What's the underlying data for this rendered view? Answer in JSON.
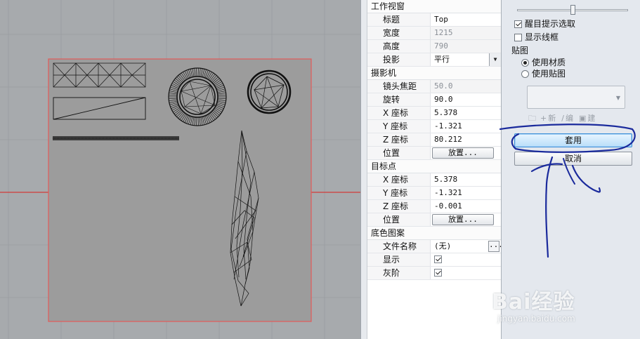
{
  "viewport": {
    "grid_color": "#999ca0",
    "axis_color": "#d23a3a",
    "frame_color": "#e35a5a"
  },
  "properties": {
    "sections": {
      "viewport_window": "工作视窗",
      "camera": "摄影机",
      "target": "目标点",
      "background": "底色图案"
    },
    "viewport_window": {
      "title_label": "标题",
      "title_value": "Top",
      "width_label": "宽度",
      "width_value": "1215",
      "height_label": "高度",
      "height_value": "790",
      "projection_label": "投影",
      "projection_value": "平行"
    },
    "camera": {
      "lens_label": "镜头焦距",
      "lens_value": "50.0",
      "rotation_label": "旋转",
      "rotation_value": "90.0",
      "x_label": "X 座标",
      "x_value": "5.378",
      "y_label": "Y 座标",
      "y_value": "-1.321",
      "z_label": "Z 座标",
      "z_value": "80.212",
      "position_label": "位置",
      "place_button": "放置..."
    },
    "target": {
      "x_label": "X 座标",
      "x_value": "5.378",
      "y_label": "Y 座标",
      "y_value": "-1.321",
      "z_label": "Z 座标",
      "z_value": "-0.001",
      "position_label": "位置",
      "place_button": "放置..."
    },
    "background": {
      "filename_label": "文件名称",
      "filename_value": "(无)",
      "browse_button": "...",
      "show_label": "显示",
      "gray_label": "灰阶"
    }
  },
  "options": {
    "slider_fraction": 0.5,
    "highlight_select": "醒目提示选取",
    "show_wireframe": "显示线框",
    "mapping_label": "贴图",
    "use_material": "使用材质",
    "use_map": "使用贴图",
    "tool_new": "新",
    "tool_edit": "编",
    "tool_create": "建",
    "apply_button": "套用",
    "cancel_button": "取消"
  },
  "watermark": {
    "logo": "Bai经验",
    "sub": "jingyan.baidu.com"
  }
}
